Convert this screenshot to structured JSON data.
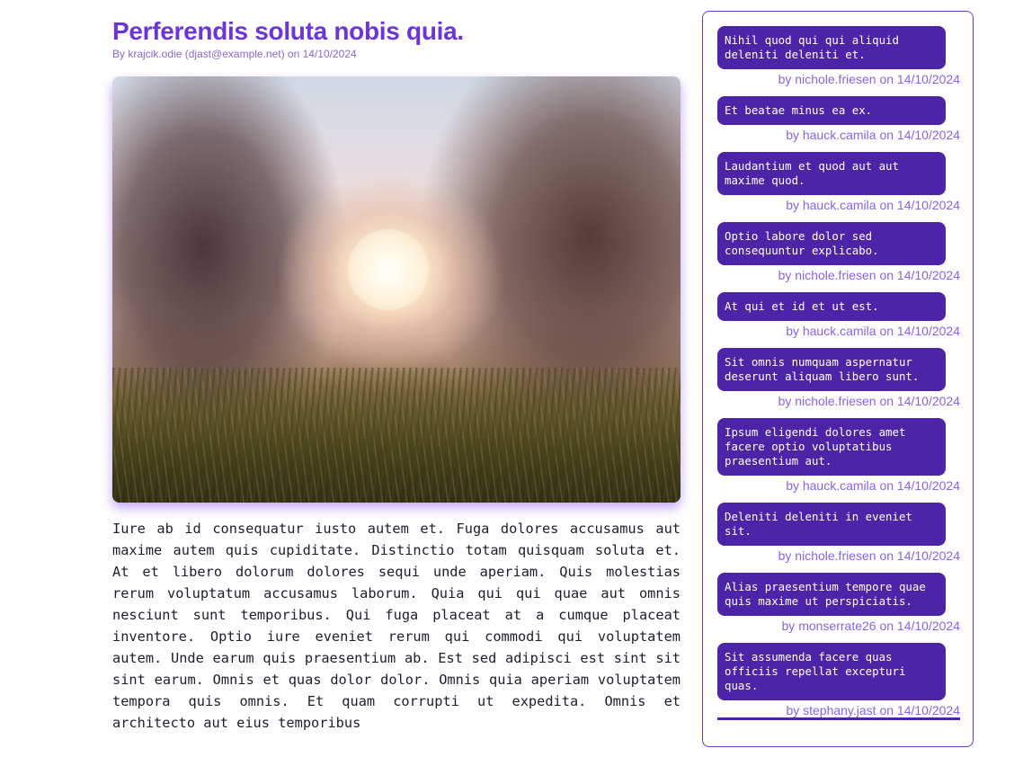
{
  "post": {
    "title": "Perferendis soluta nobis quia.",
    "byline": "By krajcik.odie (djast@example.net) on 14/10/2024",
    "body": "Iure ab id consequatur iusto autem et. Fuga dolores accusamus aut maxime autem quis cupiditate. Distinctio totam quisquam soluta et. At et libero dolorum dolores sequi unde aperiam. Quis molestias rerum voluptatum accusamus laborum. Quia qui qui quae aut omnis nesciunt sunt temporibus. Qui fuga placeat at a cumque placeat inventore. Optio iure eveniet rerum qui commodi qui voluptatem autem. Unde earum quis praesentium ab. Est sed adipisci est sint sit sint earum. Omnis et quas dolor dolor. Omnis quia aperiam voluptatem tempora quis omnis. Et quam corrupti ut expedita. Omnis et architecto aut eius temporibus"
  },
  "comments": [
    {
      "text": "Nihil quod qui qui aliquid deleniti deleniti et.",
      "meta": "by nichole.friesen on 14/10/2024"
    },
    {
      "text": "Et beatae minus ea ex.",
      "meta": "by hauck.camila on 14/10/2024"
    },
    {
      "text": "Laudantium et quod aut aut maxime quod.",
      "meta": "by hauck.camila on 14/10/2024"
    },
    {
      "text": "Optio labore dolor sed consequuntur explicabo.",
      "meta": "by nichole.friesen on 14/10/2024"
    },
    {
      "text": "At qui et id et ut est.",
      "meta": "by hauck.camila on 14/10/2024"
    },
    {
      "text": "Sit omnis numquam aspernatur deserunt aliquam libero sunt.",
      "meta": "by nichole.friesen on 14/10/2024"
    },
    {
      "text": "Ipsum eligendi dolores amet facere optio voluptatibus praesentium aut.",
      "meta": "by hauck.camila on 14/10/2024"
    },
    {
      "text": "Deleniti deleniti in eveniet sit.",
      "meta": "by nichole.friesen on 14/10/2024"
    },
    {
      "text": "Alias praesentium tempore quae quis maxime ut perspiciatis.",
      "meta": "by monserrate26 on 14/10/2024"
    },
    {
      "text": "Sit assumenda facere quas officiis repellat excepturi quas.",
      "meta": "by stephany.jast on 14/10/2024"
    }
  ],
  "colors": {
    "accent": "#6d35d8",
    "bubble": "#4d23a8",
    "meta": "#8a62ea"
  }
}
